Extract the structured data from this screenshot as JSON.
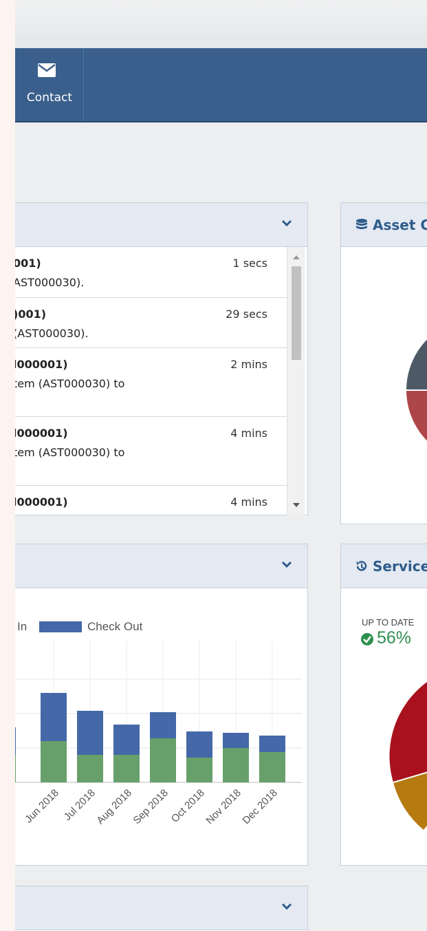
{
  "nav": {
    "contact_label": "Contact"
  },
  "activity": {
    "items": [
      {
        "who": "001)",
        "what": "AST000030).",
        "when": "1 secs"
      },
      {
        "who": ")001)",
        "what": "(AST000030).",
        "when": "29 secs"
      },
      {
        "who": "l000001)",
        "what": "tem (AST000030) to",
        "when": "2 mins"
      },
      {
        "who": "l000001)",
        "what": "tem (AST000030) to",
        "when": "4 mins"
      },
      {
        "who": "l000001)",
        "what": "",
        "when": "4 mins"
      }
    ]
  },
  "asset_panel": {
    "title": "Asset C"
  },
  "service_panel": {
    "title": "Service",
    "status_label": "UP TO DATE",
    "status_value": "56%"
  },
  "colors": {
    "check_in": "#67a06a",
    "check_out": "#4468a8",
    "nav": "#3a5f8c",
    "title": "#2e5c8a"
  },
  "chart_data": {
    "type": "bar",
    "stacked": true,
    "legend": [
      "In",
      "Check Out"
    ],
    "categories": [
      "Jun 2018",
      "Jul 2018",
      "Aug 2018",
      "Sep 2018",
      "Oct 2018",
      "Nov 2018",
      "Dec 2018"
    ],
    "series": [
      {
        "name": "Check In",
        "values": [
          3,
          2,
          2,
          3.2,
          1.8,
          2.5,
          2.2
        ]
      },
      {
        "name": "Check Out",
        "values": [
          3.5,
          3.2,
          2.2,
          1.9,
          1.9,
          1.1,
          1.2
        ]
      }
    ],
    "ylim": [
      0,
      8
    ],
    "grid": true
  }
}
